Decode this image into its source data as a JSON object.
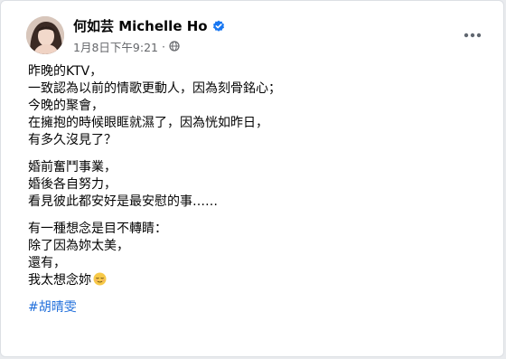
{
  "author": {
    "name": "何如芸 Michelle Ho",
    "verified_icon": "verified-badge-icon",
    "avatar_icon": "profile-avatar"
  },
  "meta": {
    "timestamp": "1月8日下午9:21",
    "separator": "·",
    "audience_icon": "globe-icon"
  },
  "menu": {
    "icon": "more-horizontal-icon"
  },
  "post": {
    "paragraphs": [
      {
        "lines": [
          "昨晚的KTV，",
          "一致認為以前的情歌更動人，因為刻骨銘心；",
          "今晚的聚會，",
          "在擁抱的時候眼眶就濕了，因為恍如昨日，",
          "有多久沒見了？"
        ]
      },
      {
        "lines": [
          "婚前奮鬥事業，",
          "婚後各自努力，",
          "看見彼此都安好是最安慰的事……"
        ]
      },
      {
        "lines": [
          "有一種想念是目不轉睛：",
          "除了因為妳太美，",
          "還有，",
          "我太想念妳"
        ],
        "trailing_emoji": "relieved-face-emoji"
      }
    ],
    "hashtag": "#胡晴雯"
  },
  "colors": {
    "link": "#216fdb",
    "verified": "#1877f2",
    "meta_text": "#65676b",
    "body_text": "#050505"
  }
}
